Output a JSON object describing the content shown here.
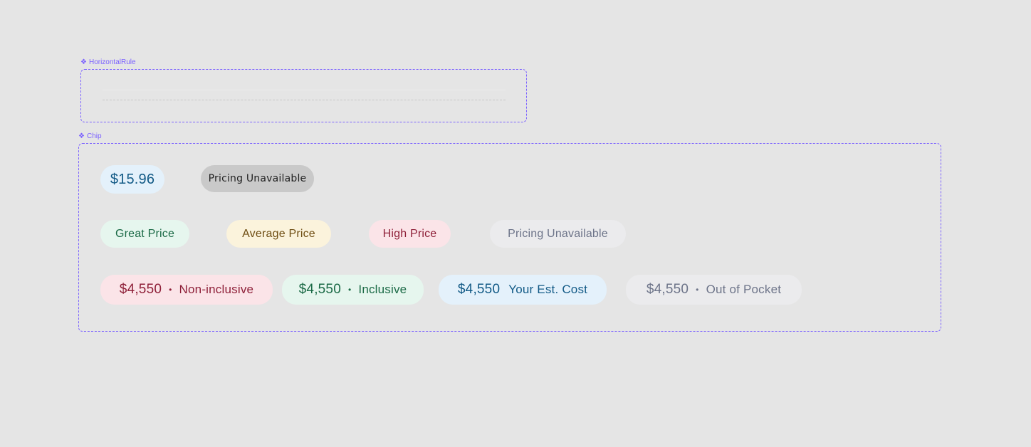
{
  "components": {
    "horizontal_rule": {
      "label": "HorizontalRule"
    },
    "chip": {
      "label": "Chip"
    }
  },
  "chips": {
    "row1": {
      "price": "$15.96",
      "unavailable_dark": "Pricing Unavailable"
    },
    "row2": {
      "great": "Great Price",
      "average": "Average Price",
      "high": "High Price",
      "unavailable": "Pricing Unavailable"
    },
    "row3": {
      "non_inclusive": {
        "price": "$4,550",
        "sep": "•",
        "label": "Non-inclusive"
      },
      "inclusive": {
        "price": "$4,550",
        "sep": "•",
        "label": "Inclusive"
      },
      "est_cost": {
        "price": "$4,550",
        "label": "Your Est. Cost"
      },
      "out_of_pocket": {
        "price": "$4,550",
        "sep": "•",
        "label": "Out of Pocket"
      }
    }
  },
  "colors": {
    "annotation": "#7b61ff",
    "blue_bg": "#e4f1fb",
    "blue_fg": "#125a86",
    "green_bg": "#e6f6ee",
    "green_fg": "#1b6a46",
    "yellow_bg": "#fbf3dc",
    "yellow_fg": "#6e4d12",
    "red_bg": "#fbe4e8",
    "red_fg": "#8e1f38",
    "gray_bg": "#ebebed",
    "gray_fg": "#6d7489",
    "dark_bg": "#c9c9c9"
  }
}
